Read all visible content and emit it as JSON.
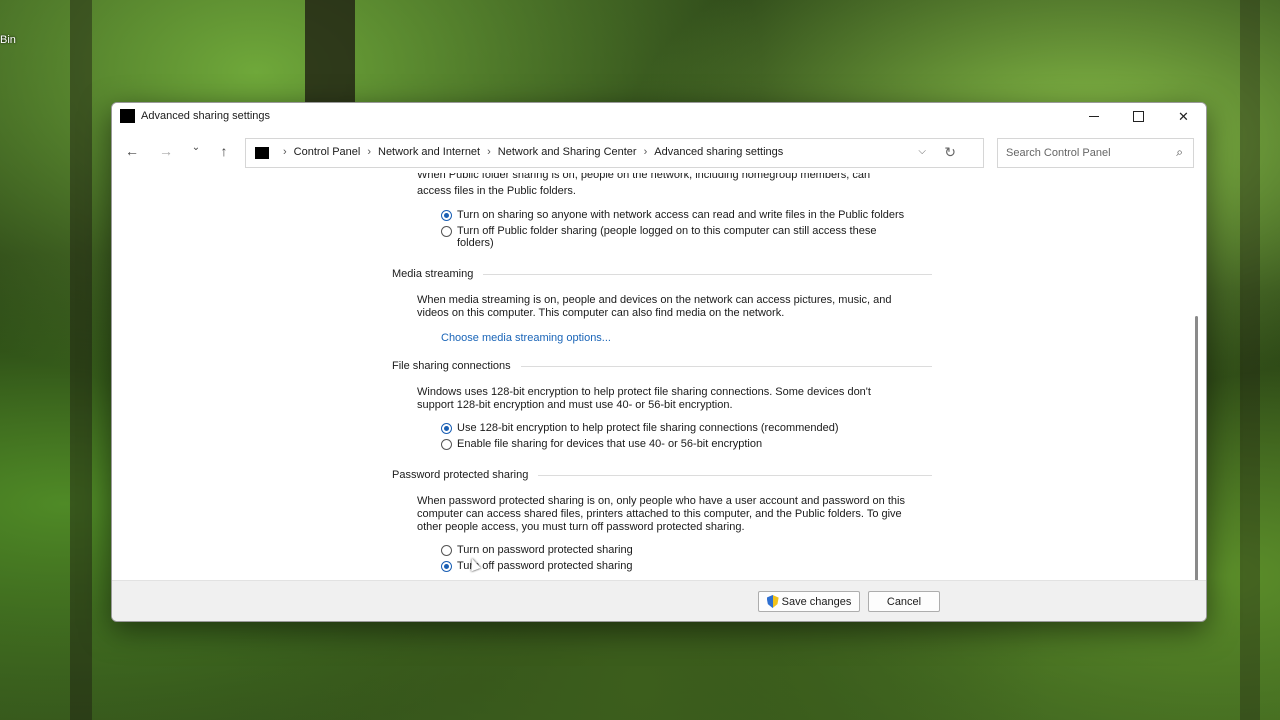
{
  "desktop": {
    "recycle_label": "Bin"
  },
  "window": {
    "title": "Advanced sharing settings"
  },
  "nav": {
    "back": "←",
    "forward": "→",
    "recent": "⌄",
    "up": "↑",
    "breadcrumbs": [
      "Control Panel",
      "Network and Internet",
      "Network and Sharing Center",
      "Advanced sharing settings"
    ],
    "search_placeholder": "Search Control Panel"
  },
  "public_folder": {
    "desc_top": "When Public folder sharing is on, people on the network, including homegroup members, can",
    "desc_bottom": "access files in the Public folders.",
    "option_on": "Turn on sharing so anyone with network access can read and write files in the Public folders",
    "option_off_line1": "Turn off Public folder sharing (people logged on to this computer can still access these",
    "option_off_line2": "folders)"
  },
  "media_streaming": {
    "heading": "Media streaming",
    "desc_line1": "When media streaming is on, people and devices on the network can access pictures, music, and",
    "desc_line2": "videos on this computer. This computer can also find media on the network.",
    "link": "Choose media streaming options..."
  },
  "file_sharing": {
    "heading": "File sharing connections",
    "desc_line1": "Windows uses 128-bit encryption to help protect file sharing connections. Some devices don't",
    "desc_line2": "support 128-bit encryption and must use 40- or 56-bit encryption.",
    "option_128": "Use 128-bit encryption to help protect file sharing connections (recommended)",
    "option_40_56": "Enable file sharing for devices that use 40- or 56-bit encryption"
  },
  "password_sharing": {
    "heading": "Password protected sharing",
    "desc_line1": "When password protected sharing is on, only people who have a user account and password on this",
    "desc_line2": "computer can access shared files, printers attached to this computer, and the Public folders. To give",
    "desc_line3": "other people access, you must turn off password protected sharing.",
    "option_on": "Turn on password protected sharing",
    "option_off": "Turn off password protected sharing"
  },
  "footer": {
    "save": "Save changes",
    "cancel": "Cancel"
  }
}
